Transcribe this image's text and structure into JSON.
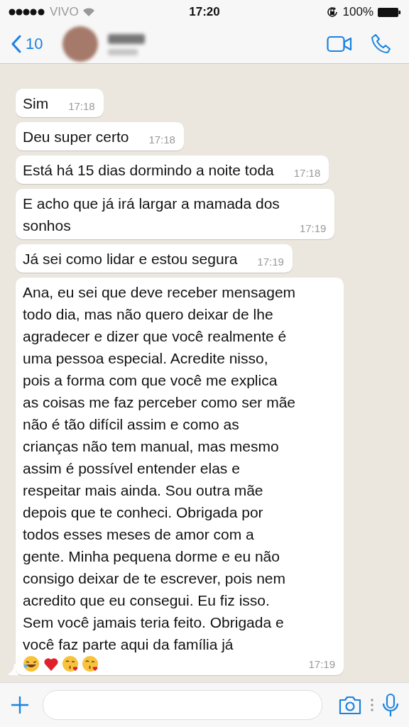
{
  "status_bar": {
    "carrier": "VIVO",
    "time": "17:20",
    "battery": "100%"
  },
  "header": {
    "back_count": "10"
  },
  "messages": [
    {
      "text": "Sim",
      "time": "17:18",
      "tail": false
    },
    {
      "text": "Deu super certo",
      "time": "17:18",
      "tail": false
    },
    {
      "text": "Está há 15 dias dormindo a noite toda",
      "time": "17:18",
      "tail": false
    },
    {
      "text": "E acho que já irá largar a mamada dos\nsonhos",
      "time": "17:19",
      "tail": false
    },
    {
      "text": "Já sei como lidar e estou segura",
      "time": "17:19",
      "tail": false
    },
    {
      "text": "Ana, eu sei que deve receber mensagem\ntodo dia, mas não quero deixar de lhe\nagradecer e dizer que você realmente é\numa pessoa especial. Acredite nisso,\npois a forma com que você me explica\nas coisas me faz perceber como ser mãe\nnão é tão difícil assim e como as\ncrianças não tem manual, mas mesmo\nassim é possível entender elas e\nrespeitar mais ainda. Sou outra mãe\ndepois que te conheci. Obrigada por\ntodos esses meses de amor com a\ngente. Minha pequena dorme e eu não\nconsigo deixar de te escrever, pois nem\nacredito que eu consegui. Eu fiz isso.\nSem você jamais teria feito. Obrigada e\nvocê faz parte aqui da família já",
      "emoji": [
        {
          "kind": "laughing"
        },
        {
          "kind": "heart"
        },
        {
          "kind": "kiss"
        },
        {
          "kind": "kiss"
        }
      ],
      "time": "17:19",
      "tail": true
    }
  ]
}
